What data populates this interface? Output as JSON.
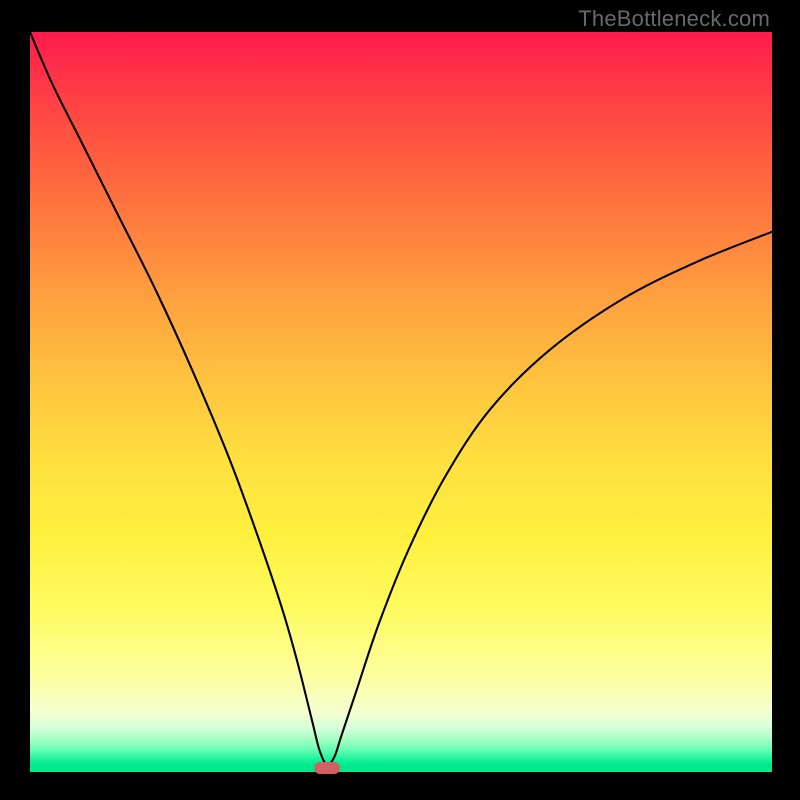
{
  "watermark": "TheBottleneck.com",
  "colors": {
    "gradient_top": "#ff1a4e",
    "gradient_mid": "#ffe03f",
    "gradient_bottom": "#00e88c",
    "curve": "#000000",
    "marker": "#cf6163",
    "background": "#000000"
  },
  "chart_data": {
    "type": "line",
    "title": "",
    "xlabel": "",
    "ylabel": "",
    "xlim": [
      0,
      100
    ],
    "ylim": [
      0,
      100
    ],
    "grid": false,
    "background_gradient": "vertical red-yellow-green",
    "annotations": [
      "TheBottleneck.com"
    ],
    "notes": "V-shaped bottleneck curve. X axis is the tunable parameter scaled 0-100; Y axis is bottleneck percentage (0 bottom = good, 100 top = severe). Minimum marked near x≈40.",
    "series": [
      {
        "name": "bottleneck-curve",
        "x": [
          0,
          3,
          7,
          12,
          17,
          22,
          27,
          31,
          34,
          36,
          38,
          39,
          40,
          41,
          42,
          44,
          47,
          51,
          56,
          62,
          70,
          80,
          90,
          100
        ],
        "y": [
          100,
          93,
          85,
          75,
          65,
          54,
          42,
          31,
          22,
          15,
          7,
          3,
          1,
          2,
          5,
          11,
          20,
          30,
          40,
          49,
          57,
          64,
          69,
          73
        ]
      }
    ],
    "marker": {
      "x": 40,
      "y": 0.5,
      "shape": "rounded-rect"
    }
  }
}
